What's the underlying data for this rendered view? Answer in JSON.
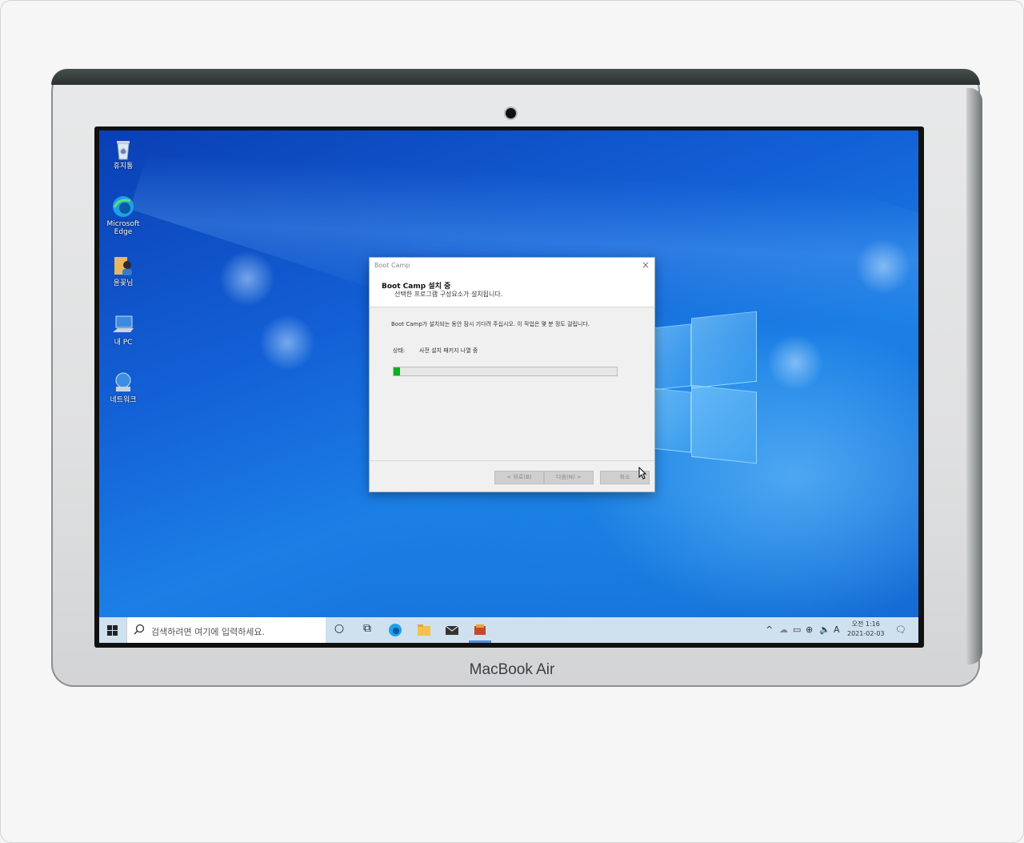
{
  "device": {
    "brand": "MacBook Air"
  },
  "desktop_icons": [
    {
      "label": "휴지통",
      "icon": "recycle-bin-icon"
    },
    {
      "label": "Microsoft Edge",
      "icon": "edge-icon"
    },
    {
      "label": "윤꽃님",
      "icon": "user-folder-icon"
    },
    {
      "label": "내 PC",
      "icon": "this-pc-icon"
    },
    {
      "label": "네트워크",
      "icon": "network-icon"
    }
  ],
  "dialog": {
    "window_title": "Boot Camp",
    "header_title": "Boot Camp 설치 중",
    "header_subtitle": "선택한 프로그램 구성요소가 설치됩니다.",
    "body_text": "Boot Camp가 설치되는 동안 잠시 기다려 주십시오. 이 작업은 몇 분 정도 걸립니다.",
    "status_label": "상태:",
    "status_value": "사전 설치 패키지 나열 중",
    "progress_fraction": 0.03,
    "progress_color": "#06b025",
    "buttons": {
      "back": "< 뒤로(B)",
      "next": "다음(N) >",
      "cancel": "취소"
    }
  },
  "taskbar": {
    "search_placeholder": "검색하려면 여기에 입력하세요.",
    "tray_input_indicator": "A",
    "clock_time": "오전 1:16",
    "clock_date": "2021-02-03"
  }
}
